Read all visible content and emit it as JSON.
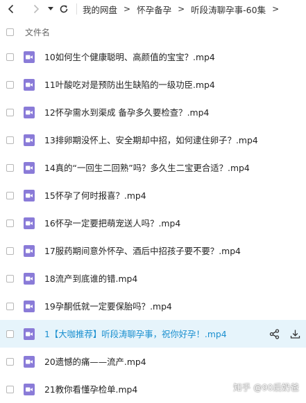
{
  "toolbar": {
    "breadcrumbs": [
      "我的网盘",
      "怀孕备孕",
      "听段涛聊孕事-60集"
    ]
  },
  "header": {
    "column_filename": "文件名"
  },
  "accent_color": "#1a8fcf",
  "icon_color": "#8a7bd8",
  "highlight_bg": "#e6f4fb",
  "files": [
    {
      "name": "10如何生个健康聪明、高颜值的宝宝？.mp4"
    },
    {
      "name": "11叶酸吃对是预防出生缺陷的一级功臣.mp4"
    },
    {
      "name": "12怀孕需水到渠成 备孕多久要检查？.mp4"
    },
    {
      "name": "13排卵期没怀上、安全期却中招，如何逮住卵子？.mp4"
    },
    {
      "name": "14真的“一回生二回熟”吗？多久生二宝更合适？.mp4"
    },
    {
      "name": "15怀孕了何时报喜？.mp4"
    },
    {
      "name": "16怀孕一定要把萌宠送人吗？.mp4"
    },
    {
      "name": "17服药期间意外怀孕、酒后中招孩子要不要？.mp4"
    },
    {
      "name": "18流产到底谁的错.mp4"
    },
    {
      "name": "19孕酮低就一定要保胎吗？.mp4"
    },
    {
      "name": "1【大咖推荐】听段涛聊孕事，祝你好孕！.mp4"
    },
    {
      "name": "20遗憾的痛——流产.mp4"
    },
    {
      "name": "21教你看懂孕检单.mp4"
    }
  ],
  "watermark": "知乎 @90后奶爸"
}
